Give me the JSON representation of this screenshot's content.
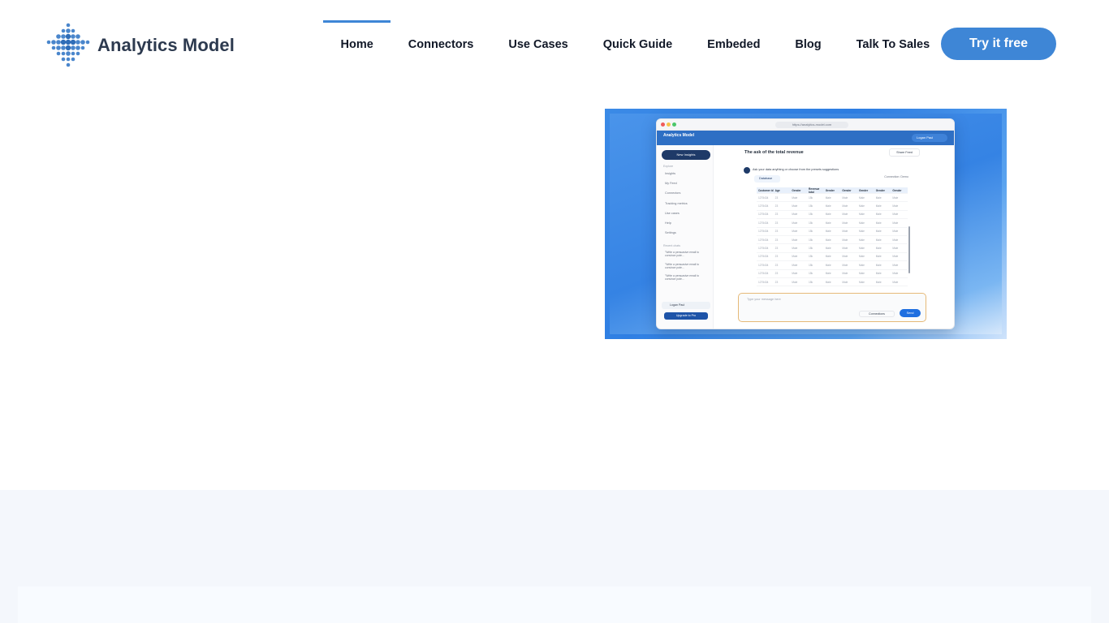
{
  "brand": {
    "name": "Analytics Model",
    "accent": "#3e86d6",
    "dark": "#2d3a4f"
  },
  "nav": {
    "items": [
      {
        "label": "Home",
        "active": true
      },
      {
        "label": "Connectors",
        "active": false
      },
      {
        "label": "Use Cases",
        "active": false
      },
      {
        "label": "Quick Guide",
        "active": false
      },
      {
        "label": "Embeded",
        "active": false
      },
      {
        "label": "Blog",
        "active": false
      },
      {
        "label": "Talk To Sales",
        "active": false
      }
    ],
    "cta_label": "Try it free"
  },
  "hero_screenshot": {
    "url": "https://analytics-model.com",
    "app_logo": "Analytics Model",
    "user_label": "Logan Paul",
    "new_insights": "New Insights",
    "explore_label": "Explore",
    "side_items": [
      "Insights",
      "My Feed",
      "Connectors",
      "Tracking metrics",
      "Use cases",
      "Help",
      "Settings"
    ],
    "recent_label": "Recent chats",
    "recent_items": [
      "\"Write a persuasive email to convince pote...",
      "\"Write a persuasive email to convince pote...",
      "\"Write a persuasive email to convince pote..."
    ],
    "user_footer": "Logan Paul",
    "upgrade": "Upgrade to Pro",
    "main_title": "The ask of the total revenue",
    "share": "Share Feed",
    "ask_text": "Ask your data anything or choose from the presets suggestions",
    "connection_label": "Connection: Demo",
    "db_chip": "Database",
    "table": {
      "headers": [
        "Customer id",
        "Age",
        "Gender",
        "Revenue total",
        "Gender",
        "Gender",
        "Gender",
        "Gender",
        "Gender"
      ],
      "row": [
        "1275434",
        "23",
        "Male",
        "15k",
        "Male",
        "Male",
        "Male",
        "Male",
        "Male"
      ],
      "row_count": 11
    },
    "composer_placeholder": "Type your message here",
    "composer_connections": "Connections",
    "send": "Send"
  }
}
